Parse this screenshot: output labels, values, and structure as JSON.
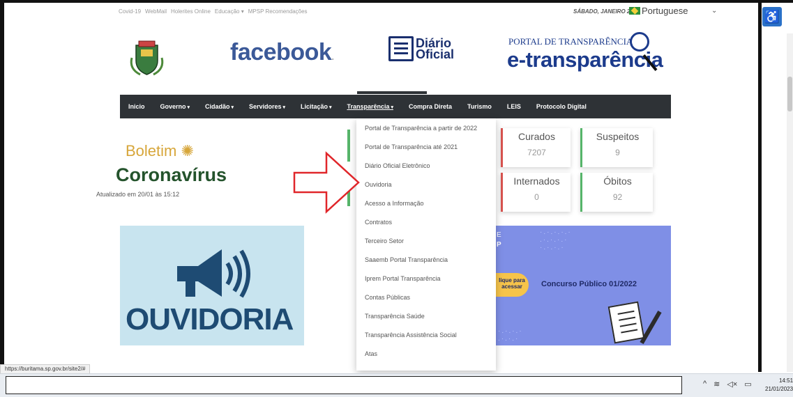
{
  "topbar": {
    "links": [
      "Covid-19",
      "WebMail",
      "Holerites Online",
      "Educação",
      "MPSP Recomendações"
    ],
    "date": "SÁBADO, JANEIRO 21",
    "language": "Portuguese"
  },
  "header": {
    "facebook": "facebook",
    "diario": [
      "Diário",
      "Oficial"
    ],
    "et_top": "PORTAL DE TRANSPARÊNCIA",
    "et_main": "e-transparência"
  },
  "nav": {
    "items": [
      {
        "label": "Inicio"
      },
      {
        "label": "Governo"
      },
      {
        "label": "Cidadão"
      },
      {
        "label": "Servidores"
      },
      {
        "label": "Licitação"
      },
      {
        "label": "Transparência"
      },
      {
        "label": "Compra Direta"
      },
      {
        "label": "Turismo"
      },
      {
        "label": "LEIS"
      },
      {
        "label": "Protocolo Digital"
      }
    ]
  },
  "dropdown": {
    "items": [
      "Portal de Transparência a partir de 2022",
      "Portal de Transparência até 2021",
      "Diário Oficial Eletrônico",
      "Ouvidoria",
      "Acesso a Informação",
      "Contratos",
      "Terceiro Setor",
      "Saaemb Portal Transparência",
      "Iprem Portal Transparência",
      "Contas Públicas",
      "Transparência Saúde",
      "Transparência Assistência Social",
      "Atas"
    ]
  },
  "boletim": {
    "title": "Boletim",
    "subtitle": "Coronavírus",
    "updated": "Atualizado em 20/01 às 15:12"
  },
  "stats": {
    "curados": {
      "label": "Curados",
      "value": "7207"
    },
    "suspeitos": {
      "label": "Suspeitos",
      "value": "9"
    },
    "internados": {
      "label": "Internados",
      "value": "0"
    },
    "obitos": {
      "label": "Óbitos",
      "value": "92"
    }
  },
  "banners": {
    "ouvidoria": "OUVIDORIA",
    "concurso_e": "E",
    "concurso_p": "P",
    "concurso_click": [
      "lique para",
      "acessar"
    ],
    "concurso_title": "Concurso Público 01/2022"
  },
  "status_url": "https://buritama.sp.gov.br/site2/#",
  "clock": {
    "time": "14:51",
    "date": "21/01/2023"
  },
  "colors": {
    "nav_bg": "#2e3236",
    "accent_green": "#24532c",
    "facebook": "#3b5998",
    "etransp": "#1c3b8c",
    "arrow": "#e0262a"
  }
}
